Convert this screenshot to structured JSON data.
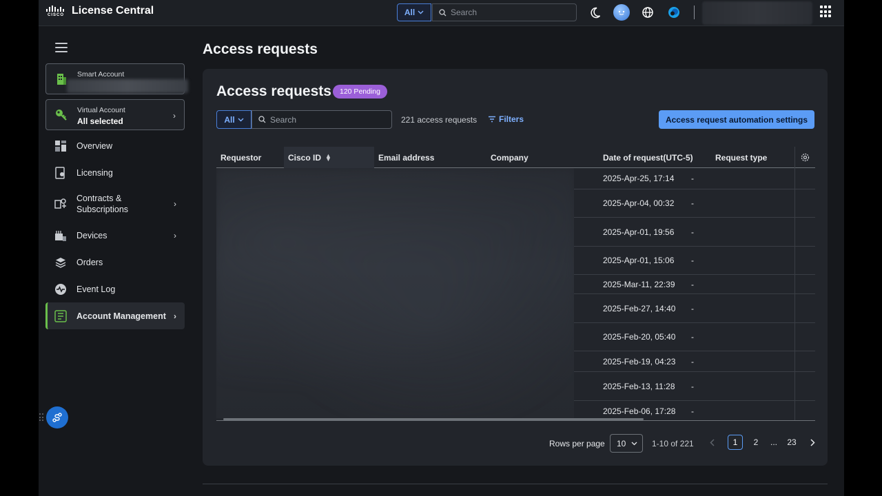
{
  "app": {
    "title": "License Central",
    "logo_text": "CISCO"
  },
  "topbar": {
    "scope": "All",
    "search_placeholder": "Search",
    "icons": [
      "theme-icon",
      "assistant-icon",
      "globe-icon",
      "webex-icon",
      "apps-grid-icon"
    ]
  },
  "sidebar": {
    "smart_account": {
      "label": "Smart Account",
      "value": ""
    },
    "virtual_account": {
      "label": "Virtual Account",
      "value": "All selected"
    },
    "items": [
      {
        "label": "Overview",
        "icon": "overview-icon"
      },
      {
        "label": "Licensing",
        "icon": "licensing-icon"
      },
      {
        "label": "Contracts &",
        "label2": "Subscriptions",
        "icon": "contracts-icon"
      },
      {
        "label": "Devices",
        "icon": "devices-icon"
      },
      {
        "label": "Orders",
        "icon": "orders-icon"
      },
      {
        "label": "Event Log",
        "icon": "event-log-icon"
      },
      {
        "label": "Account Management",
        "icon": "account-management-icon"
      }
    ]
  },
  "page": {
    "title": "Access requests"
  },
  "card": {
    "title": "Access requests",
    "pending_badge": "120 Pending",
    "scope": "All",
    "search_placeholder": "Search",
    "count": "221 access requests",
    "filters_label": "Filters",
    "automation_button": "Access request automation settings"
  },
  "table": {
    "columns": [
      "Requestor",
      "Cisco ID",
      "Email address",
      "Company",
      "Date of request(UTC-5)",
      "Request type"
    ],
    "rows": [
      {
        "date": "2025-Apr-25, 17:14",
        "type": "-"
      },
      {
        "date": "2025-Apr-04, 00:32",
        "type": "-"
      },
      {
        "date": "2025-Apr-01, 19:56",
        "type": "-"
      },
      {
        "date": "2025-Apr-01, 15:06",
        "type": "-"
      },
      {
        "date": "2025-Mar-11, 22:39",
        "type": "-"
      },
      {
        "date": "2025-Feb-27, 14:40",
        "type": "-"
      },
      {
        "date": "2025-Feb-20, 05:40",
        "type": "-"
      },
      {
        "date": "2025-Feb-19, 04:23",
        "type": "-"
      },
      {
        "date": "2025-Feb-13, 11:28",
        "type": "-"
      },
      {
        "date": "2025-Feb-06, 17:28",
        "type": "-"
      }
    ]
  },
  "pagination": {
    "rows_per_page_label": "Rows per page",
    "rows_per_page": "10",
    "range": "1-10 of 221",
    "pages": [
      "1",
      "2",
      "...",
      "23"
    ],
    "current": "1"
  },
  "colors": {
    "accent": "#5b9cf5",
    "pending": "#9b5fd8",
    "active_nav": "#6abf4b"
  }
}
